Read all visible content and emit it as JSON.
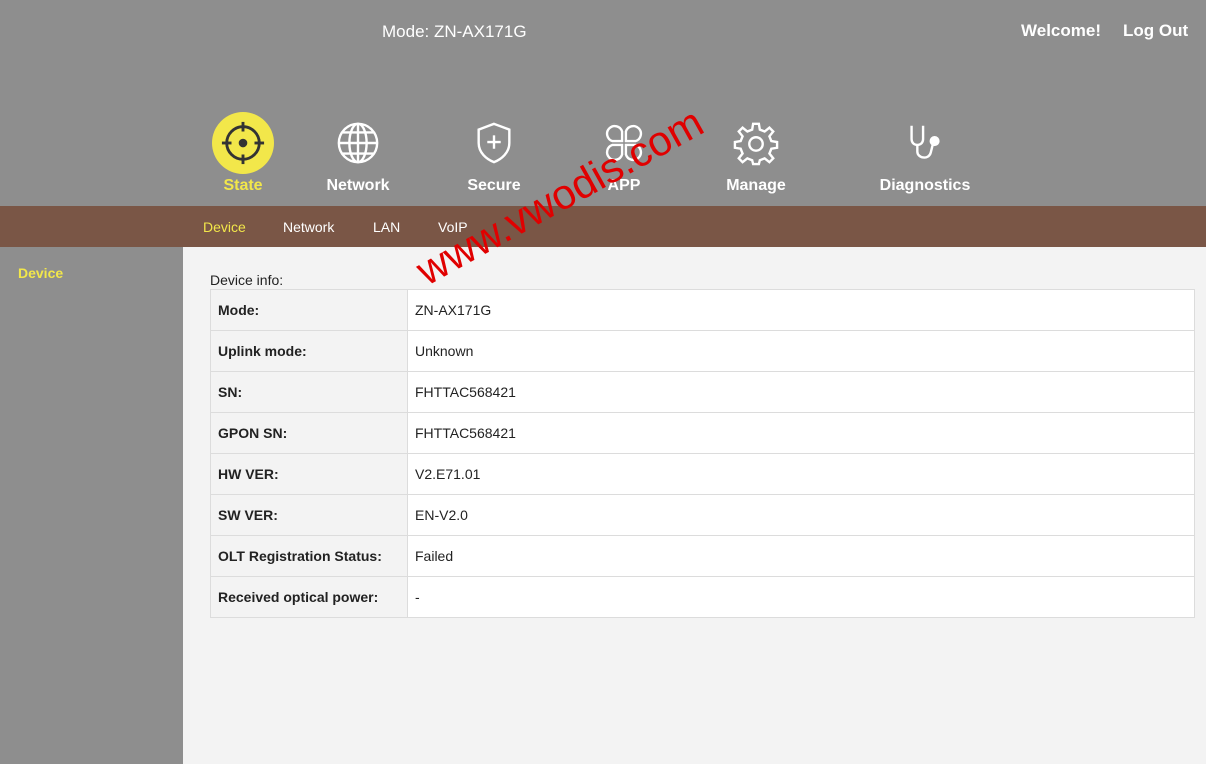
{
  "header": {
    "mode_title": "Mode: ZN-AX171G",
    "welcome": "Welcome!",
    "logout": "Log Out"
  },
  "nav": [
    {
      "label": "State",
      "icon": "crosshair-icon",
      "active": true
    },
    {
      "label": "Network",
      "icon": "globe-icon",
      "active": false
    },
    {
      "label": "Secure",
      "icon": "shield-plus-icon",
      "active": false
    },
    {
      "label": "APP",
      "icon": "app-grid-icon",
      "active": false
    },
    {
      "label": "Manage",
      "icon": "gear-icon",
      "active": false
    },
    {
      "label": "Diagnostics",
      "icon": "stethoscope-icon",
      "active": false
    }
  ],
  "subnav": [
    {
      "label": "Device",
      "active": true
    },
    {
      "label": "Network",
      "active": false
    },
    {
      "label": "LAN",
      "active": false
    },
    {
      "label": "VoIP",
      "active": false
    }
  ],
  "sidebar": {
    "items": [
      {
        "label": "Device",
        "active": true
      }
    ]
  },
  "main": {
    "section_title": "Device info:",
    "rows": [
      {
        "label": "Mode:",
        "value": "ZN-AX171G"
      },
      {
        "label": "Uplink mode:",
        "value": "Unknown"
      },
      {
        "label": "SN:",
        "value": "FHTTAC568421"
      },
      {
        "label": "GPON SN:",
        "value": "FHTTAC568421"
      },
      {
        "label": "HW VER:",
        "value": "V2.E71.01"
      },
      {
        "label": "SW VER:",
        "value": "EN-V2.0"
      },
      {
        "label": "OLT Registration Status:",
        "value": "Failed"
      },
      {
        "label": "Received optical power:",
        "value": "-"
      }
    ]
  },
  "watermark": "www.vwodis.com",
  "colors": {
    "header_bg": "#8e8e8e",
    "subnav_bg": "#7a5646",
    "accent": "#f2e74a",
    "content_bg": "#f3f3f3",
    "watermark": "#e00000"
  }
}
